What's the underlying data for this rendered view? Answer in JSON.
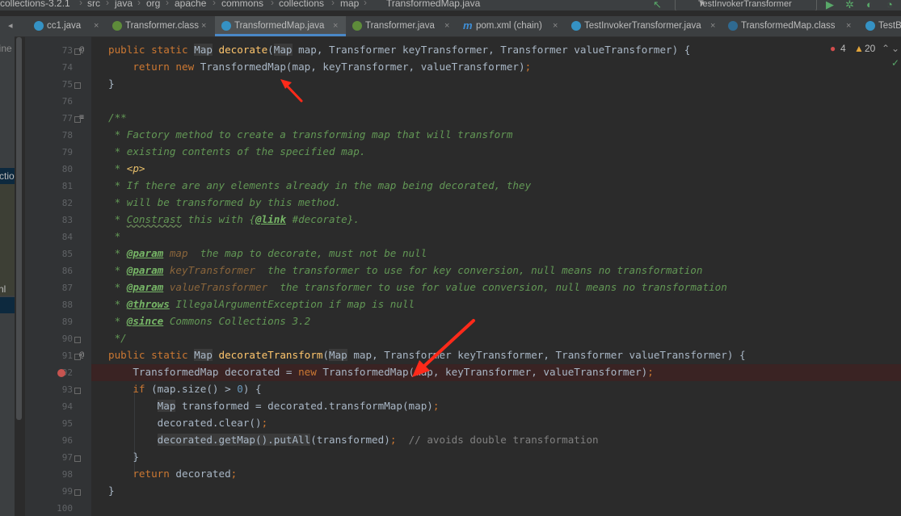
{
  "breadcrumb": [
    "collections-3.2.1",
    "src",
    "java",
    "org",
    "apache",
    "commons",
    "collections",
    "map",
    "TransformedMap.java"
  ],
  "run_config": "TestInvokerTransformer",
  "tabs": [
    {
      "label": "cc1.java",
      "icon": "class-icon",
      "active": false
    },
    {
      "label": "Transformer.class",
      "icon": "interface-icon",
      "active": false
    },
    {
      "label": "TransformedMap.java",
      "icon": "class-icon",
      "active": true
    },
    {
      "label": "Transformer.java",
      "icon": "interface-icon",
      "active": false
    },
    {
      "label": "pom.xml (chain)",
      "icon": "maven-icon",
      "active": false
    },
    {
      "label": "TestInvokerTransformer.java",
      "icon": "class-icon",
      "active": false
    },
    {
      "label": "TransformedMap.class",
      "icon": "class-icon",
      "active": false
    },
    {
      "label": "TestB",
      "icon": "class-icon",
      "active": false
    }
  ],
  "left_panel": {
    "line1": "line",
    "line2": "ctio",
    "line3": "nl"
  },
  "inspections": {
    "errors": "4",
    "warnings": "20"
  },
  "line_numbers": [
    "73",
    "74",
    "75",
    "76",
    "77",
    "78",
    "79",
    "80",
    "81",
    "82",
    "83",
    "84",
    "85",
    "86",
    "87",
    "88",
    "89",
    "90",
    "91",
    "92",
    "93",
    "94",
    "95",
    "96",
    "97",
    "98",
    "99",
    "100"
  ],
  "gutter_marks": {
    "override_symbol": "@",
    "doc_symbol": "≡"
  },
  "code": {
    "l73": {
      "kw1": "public static ",
      "t1": "Map",
      "fn": "decorate",
      "t2": "Map",
      "rest": " map, Transformer keyTransformer, Transformer valueTransformer) {"
    },
    "l74": {
      "kw": "return new ",
      "rest": "TransformedMap(map, keyTransformer, valueTransformer)",
      "semi": ";"
    },
    "l75": "}",
    "l77": "/**",
    "l78": " * Factory method to create a transforming map that will transform",
    "l79": " * existing contents of the specified map.",
    "l80": {
      "prefix": " * ",
      "tag": "<p>"
    },
    "l81": " * If there are any elements already in the map being decorated, they",
    "l82": " * will be transformed by this method.",
    "l83": {
      "prefix": " * ",
      "word": "Constrast",
      "mid": " this with {",
      "link": "@link",
      "end": " #decorate}."
    },
    "l84": " *",
    "l85": {
      "prefix": " * ",
      "tag": "@param",
      "pname": " map",
      "desc": "  the map to decorate, must not be null"
    },
    "l86": {
      "prefix": " * ",
      "tag": "@param",
      "pname": " keyTransformer",
      "desc": "  the transformer to use for key conversion, null means no transformation"
    },
    "l87": {
      "prefix": " * ",
      "tag": "@param",
      "pname": " valueTransformer",
      "desc": "  the transformer to use for value conversion, null means no transformation"
    },
    "l88": {
      "prefix": " * ",
      "tag": "@throws",
      "desc": " IllegalArgumentException if map is null"
    },
    "l89": {
      "prefix": " * ",
      "tag": "@since",
      "desc": " Commons Collections 3.2"
    },
    "l90": " */",
    "l91": {
      "kw1": "public static ",
      "t1": "Map",
      "fn": "decorateTransform",
      "t2": "Map",
      "rest": " map, Transformer keyTransformer, Transformer valueTransformer) {"
    },
    "l92": {
      "a": "TransformedMap decorated = ",
      "kw": "new ",
      "b": "TransformedMap(map, keyTransformer, valueTransformer)",
      "semi": ";"
    },
    "l93": {
      "kw": "if ",
      "a": "(map.size() > ",
      "num": "0",
      "b": ") {"
    },
    "l94": {
      "t": "Map",
      "rest": " transformed = decorated.transformMap(map)",
      "semi": ";"
    },
    "l95": {
      "rest": "decorated.clear()",
      "semi": ";"
    },
    "l96": {
      "hl": "decorated.getMap().putAll",
      "rest": "(transformed)",
      "semi": ";",
      "comment": "  // avoids double transformation"
    },
    "l97": "}",
    "l98": {
      "kw": "return ",
      "rest": "decorated",
      "semi": ";"
    },
    "l99": "}"
  },
  "colors": {
    "annotation_arrow": "#ff2a1a",
    "breakpoint": "#c75450",
    "accent": "#4a88c7"
  }
}
